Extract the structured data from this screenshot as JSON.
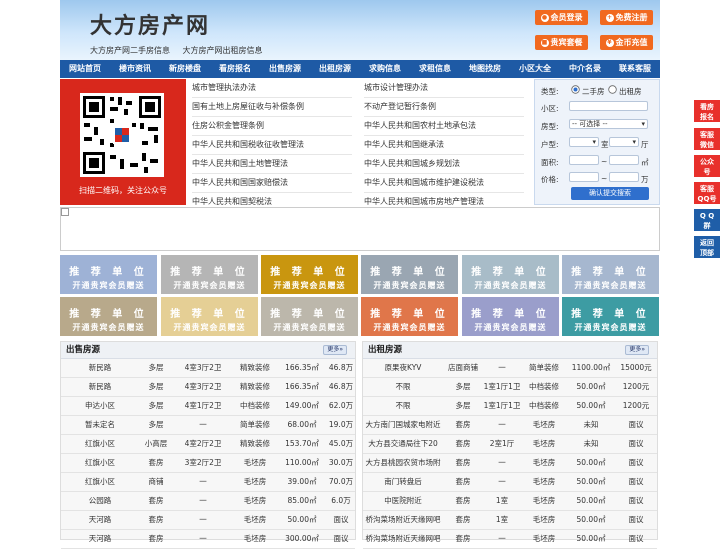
{
  "header": {
    "logo": "大方房产网",
    "subtitle_1": "大方房产网二手房信息",
    "subtitle_2": "大方房产网出租房信息",
    "buttons": [
      {
        "label": "会员登录",
        "icon": "user-icon"
      },
      {
        "label": "免费注册",
        "icon": "person-plus-icon"
      },
      {
        "label": "贵宾套餐",
        "icon": "gift-icon"
      },
      {
        "label": "金币充值",
        "icon": "coin-icon"
      }
    ],
    "accent": "#f1691f"
  },
  "nav": [
    "网站首页",
    "楼市资讯",
    "新房楼盘",
    "看房报名",
    "出售房源",
    "出租房源",
    "求购信息",
    "求租信息",
    "地图找房",
    "小区大全",
    "中介名录",
    "联系客服"
  ],
  "qr": {
    "caption": "扫描二维码，关注公众号"
  },
  "links_left": [
    "城市管理执法办法",
    "国有土地上房屋征收与补偿条例",
    "住房公积金管理条例",
    "中华人民共和国税收征收管理法",
    "中华人民共和国土地管理法",
    "中华人民共和国国家赔偿法",
    "中华人民共和国契税法"
  ],
  "links_right": [
    "城市设计管理办法",
    "不动产登记暂行条例",
    "中华人民共和国农村土地承包法",
    "中华人民共和国继承法",
    "中华人民共和国城乡规划法",
    "中华人民共和国城市维护建设税法",
    "中华人民共和国城市房地产管理法"
  ],
  "search": {
    "type_label": "类型:",
    "type_options": [
      "二手房",
      "出租房"
    ],
    "type_selected": "二手房",
    "community_label": "小区:",
    "community_value": "",
    "houseform_label": "房型:",
    "houseform_value": "-- 可选择 --",
    "layout_label": "户型:",
    "room_unit": "室",
    "hall_unit": "厅",
    "area_label": "面积:",
    "area_unit": "㎡",
    "area_sep": "~",
    "price_label": "价格:",
    "price_unit": "万",
    "price_sep": "~",
    "submit": "确认提交搜索"
  },
  "recommend": {
    "title": "推 荐 单 位",
    "subtitle": "开通贵宾会员赠送",
    "colors": [
      "#9eb2d6",
      "#b5b5b5",
      "#c9960f",
      "#9aa6b2",
      "#a8bcc8",
      "#a6b7cf",
      "#b8a98b",
      "#e5cf95",
      "#bcb7ab",
      "#e0764a",
      "#9a9ecb",
      "#3d9ca3"
    ]
  },
  "sale": {
    "title": "出售房源",
    "more": "更多",
    "rows": [
      [
        "新民路",
        "多层",
        "4室3厅2卫",
        "精致装修",
        "166.35㎡",
        "46.8万"
      ],
      [
        "新民路",
        "多层",
        "4室3厅2卫",
        "精致装修",
        "166.35㎡",
        "46.8万"
      ],
      [
        "申达小区",
        "多层",
        "4室1厅2卫",
        "中档装修",
        "149.00㎡",
        "62.0万"
      ],
      [
        "暂未定名",
        "多层",
        "一",
        "简单装修",
        "68.00㎡",
        "19.0万"
      ],
      [
        "红旗小区",
        "小高层",
        "4室2厅2卫",
        "精致装修",
        "153.70㎡",
        "45.0万"
      ],
      [
        "红旗小区",
        "套房",
        "3室2厅2卫",
        "毛坯房",
        "110.00㎡",
        "30.0万"
      ],
      [
        "红旗小区",
        "商铺",
        "一",
        "毛坯房",
        "39.00㎡",
        "70.0万"
      ],
      [
        "公园路",
        "套房",
        "一",
        "毛坯房",
        "85.00㎡",
        "6.0万"
      ],
      [
        "天河路",
        "套房",
        "一",
        "毛坯房",
        "50.00㎡",
        "面议"
      ],
      [
        "天河路",
        "套房",
        "一",
        "毛坯房",
        "300.00㎡",
        "面议"
      ]
    ]
  },
  "rent": {
    "title": "出租房源",
    "more": "更多",
    "rows": [
      [
        "原果夜KYV",
        "店面商铺",
        "一",
        "简单装修",
        "1100.00㎡",
        "15000元"
      ],
      [
        "不限",
        "多层",
        "1室1厅1卫",
        "中档装修",
        "50.00㎡",
        "1200元"
      ],
      [
        "不限",
        "多层",
        "1室1厅1卫",
        "中档装修",
        "50.00㎡",
        "1200元"
      ],
      [
        "大方南门国城家电附近",
        "套房",
        "一",
        "毛坯房",
        "未知",
        "面议"
      ],
      [
        "大方县交通局往下20",
        "套房",
        "2室1厅",
        "毛坯房",
        "未知",
        "面议"
      ],
      [
        "大方县桃园农贸市场附",
        "套房",
        "一",
        "毛坯房",
        "50.00㎡",
        "面议"
      ],
      [
        "南门转盘后",
        "套房",
        "一",
        "毛坯房",
        "50.00㎡",
        "面议"
      ],
      [
        "中医院附近",
        "套房",
        "1室",
        "毛坯房",
        "50.00㎡",
        "面议"
      ],
      [
        "桥沟菜场附近天缘网吧",
        "套房",
        "1室",
        "毛坯房",
        "50.00㎡",
        "面议"
      ],
      [
        "桥沟菜场附近天缘网吧",
        "套房",
        "一",
        "毛坯房",
        "50.00㎡",
        "面议"
      ]
    ]
  },
  "float_bar": [
    {
      "label1": "看房",
      "label2": "报名",
      "color": "#e8302b"
    },
    {
      "label1": "客服",
      "label2": "微信",
      "color": "#e8302b"
    },
    {
      "label1": "公众",
      "label2": "号",
      "color": "#e8302b"
    },
    {
      "label1": "客服",
      "label2": "QQ号",
      "color": "#e8302b"
    },
    {
      "label1": "Q Q",
      "label2": "群",
      "color": "#1f5ea8"
    },
    {
      "label1": "返回",
      "label2": "顶部",
      "color": "#1f5ea8"
    }
  ]
}
